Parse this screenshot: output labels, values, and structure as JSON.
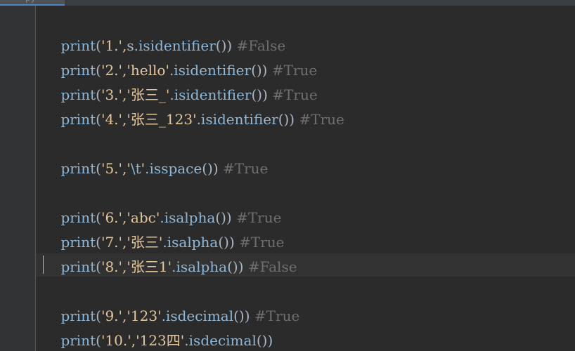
{
  "editor": {
    "tab_label": "py",
    "lines": [
      {
        "fn": "print",
        "open": "(",
        "q": "'",
        "arg1": "1.",
        "sep": "',",
        "obj": "s",
        "method": ".isidentifier",
        "call": "()",
        "close": ")",
        "comment": "#False"
      },
      {
        "fn": "print",
        "open": "(",
        "q": "'",
        "arg1": "2.",
        "sep": "','",
        "obj": "hello",
        "objq": "'",
        "method": ".isidentifier",
        "call": "()",
        "close": ")",
        "comment": "#True"
      },
      {
        "fn": "print",
        "open": "(",
        "q": "'",
        "arg1": "3.",
        "sep": "','",
        "obj": "张三_",
        "objq": "'",
        "method": ".isidentifier",
        "call": "()",
        "close": ")",
        "comment": "#True"
      },
      {
        "fn": "print",
        "open": "(",
        "q": "'",
        "arg1": "4.",
        "sep": "','",
        "obj": "张三_123",
        "objq": "'",
        "method": ".isidentifier",
        "call": "()",
        "close": ")",
        "comment": "#True"
      },
      {
        "fn": "print",
        "open": "(",
        "q": "'",
        "arg1": "5.",
        "sep": "','",
        "obj": "\\t",
        "objq": "'",
        "method": ".isspace",
        "call": "()",
        "close": ")",
        "comment": "#True"
      },
      {
        "fn": "print",
        "open": "(",
        "q": "'",
        "arg1": "6.",
        "sep": "','",
        "obj": "abc",
        "objq": "'",
        "method": ".isalpha",
        "call": "()",
        "close": ")",
        "comment": "#True"
      },
      {
        "fn": "print",
        "open": "(",
        "q": "'",
        "arg1": "7.",
        "sep": "','",
        "obj": "张三",
        "objq": "'",
        "method": ".isalpha",
        "call": "()",
        "close": ")",
        "comment": "#True"
      },
      {
        "fn": "print",
        "open": "(",
        "q": "'",
        "arg1": "8.",
        "sep": "','",
        "obj": "张三1",
        "objq": "'",
        "method": ".isalpha",
        "call": "()",
        "close": ")",
        "comment": "#False"
      },
      {
        "fn": "print",
        "open": "(",
        "q": "'",
        "arg1": "9.",
        "sep": "','",
        "obj": "123",
        "objq": "'",
        "method": ".isdecimal",
        "call": "()",
        "close": ")",
        "comment": "#True"
      },
      {
        "fn": "print",
        "open": "(",
        "q": "'",
        "arg1": "10.",
        "sep": "','",
        "obj": "123四",
        "objq": "'",
        "method": ".isdecimal",
        "call": "()",
        "close": ")",
        "comment": ""
      }
    ]
  },
  "colors": {
    "background": "#2b2b2b",
    "builtin": "#8fb8d8",
    "string": "#e3c79e",
    "comment": "#6f6f6f",
    "current_line": "#323232"
  }
}
